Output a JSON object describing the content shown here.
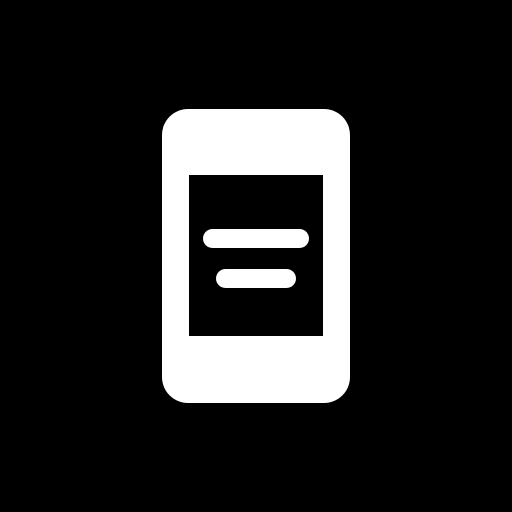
{
  "icon": {
    "name": "mobile-document-icon",
    "colors": {
      "background": "#000000",
      "foreground": "#ffffff"
    }
  }
}
